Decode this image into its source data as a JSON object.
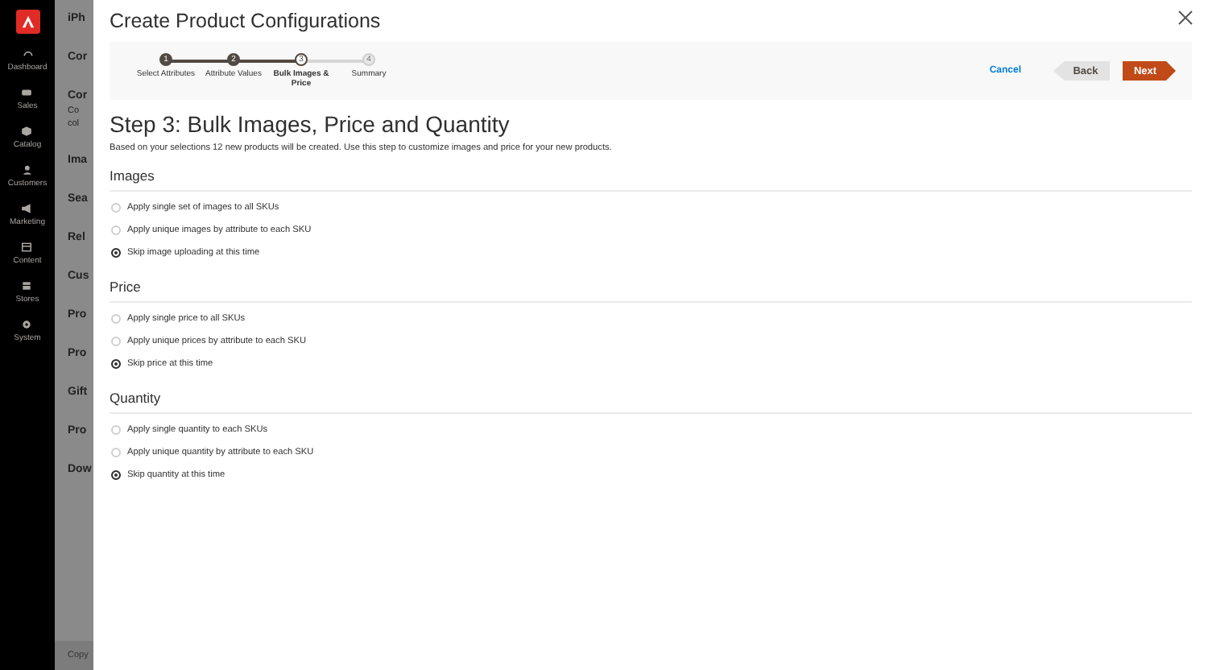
{
  "sidebar": {
    "items": [
      {
        "label": "Dashboard"
      },
      {
        "label": "Sales"
      },
      {
        "label": "Catalog"
      },
      {
        "label": "Customers"
      },
      {
        "label": "Marketing"
      },
      {
        "label": "Content"
      },
      {
        "label": "Stores"
      },
      {
        "label": "System"
      }
    ]
  },
  "background_page": {
    "items": [
      {
        "text": "iPh",
        "kind": "title"
      },
      {
        "text": "Cor",
        "kind": "section"
      },
      {
        "text": "Cor",
        "kind": "section"
      },
      {
        "text": "Co",
        "kind": "note"
      },
      {
        "text": "col",
        "kind": "note"
      },
      {
        "text": "Ima",
        "kind": "section"
      },
      {
        "text": "Sea",
        "kind": "section"
      },
      {
        "text": "Rel",
        "kind": "section"
      },
      {
        "text": "Cus",
        "kind": "section"
      },
      {
        "text": "Pro",
        "kind": "section"
      },
      {
        "text": "Pro",
        "kind": "section"
      },
      {
        "text": "Gift",
        "kind": "section"
      },
      {
        "text": "Pro",
        "kind": "section"
      },
      {
        "text": "Dow",
        "kind": "section"
      }
    ],
    "footer": "Copy"
  },
  "modal": {
    "title": "Create Product Configurations",
    "steps": [
      {
        "number": "1",
        "label": "Select Attributes",
        "completed": true,
        "selected": false
      },
      {
        "number": "2",
        "label": "Attribute Values",
        "completed": true,
        "selected": false
      },
      {
        "number": "3",
        "label": "Bulk Images & Price",
        "completed": false,
        "selected": true
      },
      {
        "number": "4",
        "label": "Summary",
        "completed": false,
        "selected": false
      }
    ],
    "actions": {
      "cancel": "Cancel",
      "back": "Back",
      "next": "Next"
    },
    "heading": "Step 3: Bulk Images, Price and Quantity",
    "description": "Based on your selections 12 new products will be created. Use this step to customize images and price for your new products.",
    "sections": [
      {
        "title": "Images",
        "options": [
          {
            "label": "Apply single set of images to all SKUs",
            "selected": false
          },
          {
            "label": "Apply unique images by attribute to each SKU",
            "selected": false
          },
          {
            "label": "Skip image uploading at this time",
            "selected": true
          }
        ]
      },
      {
        "title": "Price",
        "options": [
          {
            "label": "Apply single price to all SKUs",
            "selected": false
          },
          {
            "label": "Apply unique prices by attribute to each SKU",
            "selected": false
          },
          {
            "label": "Skip price at this time",
            "selected": true
          }
        ]
      },
      {
        "title": "Quantity",
        "options": [
          {
            "label": "Apply single quantity to each SKUs",
            "selected": false
          },
          {
            "label": "Apply unique quantity by attribute to each SKU",
            "selected": false
          },
          {
            "label": "Skip quantity at this time",
            "selected": true
          }
        ]
      }
    ]
  }
}
